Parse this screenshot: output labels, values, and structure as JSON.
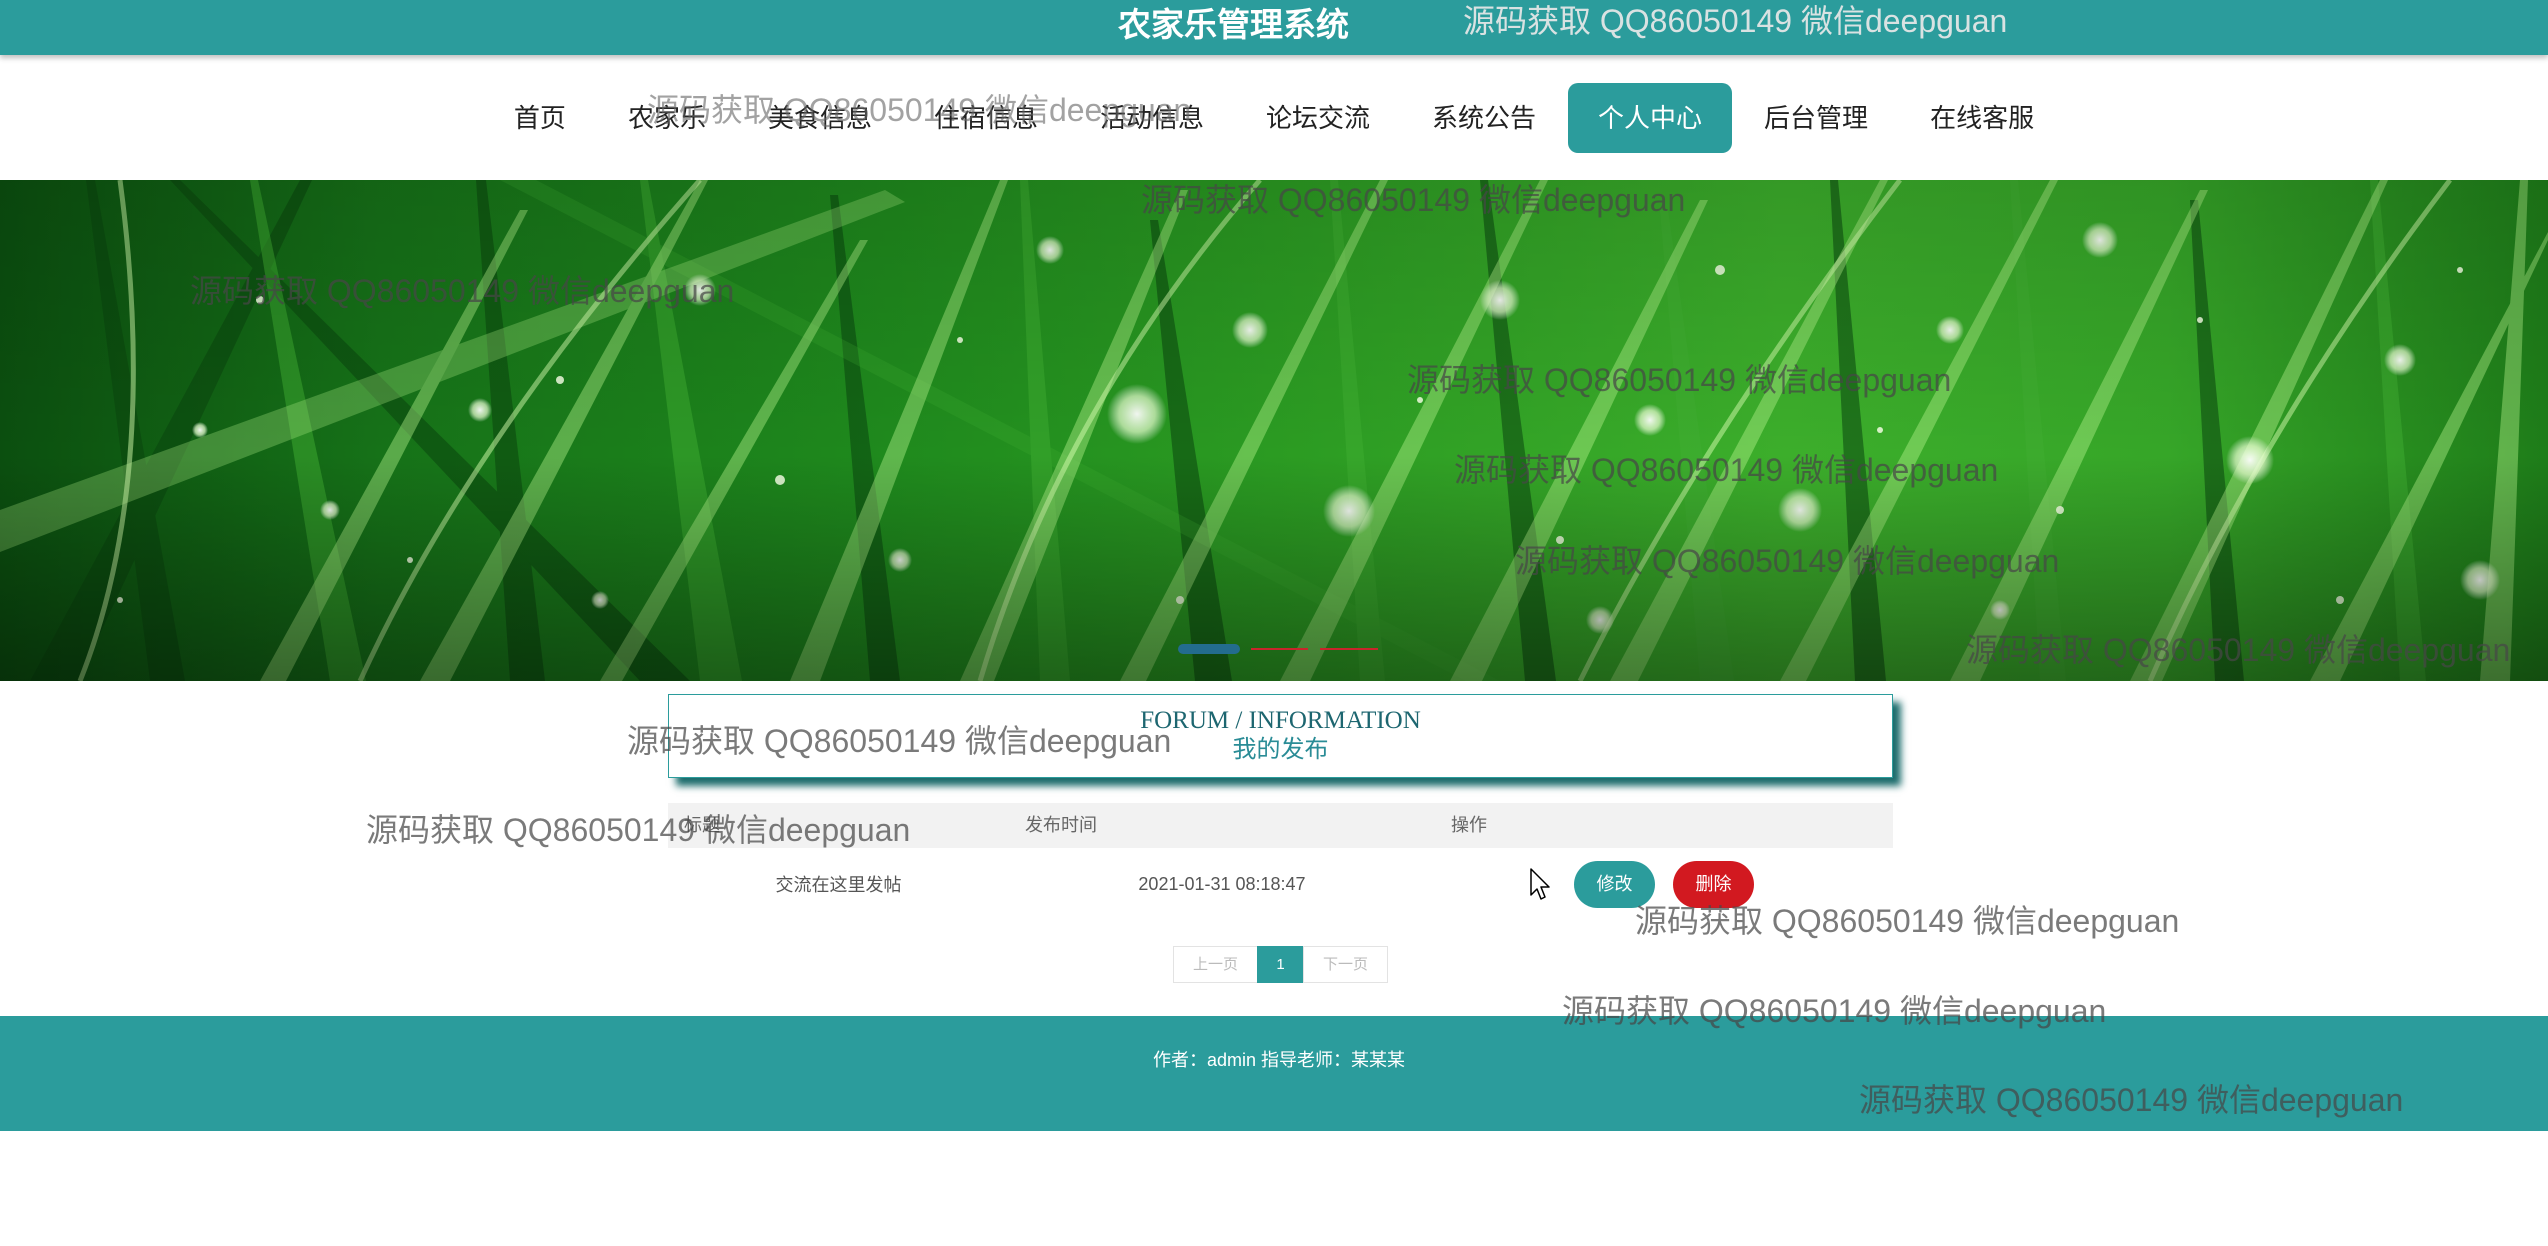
{
  "header": {
    "title": "农家乐管理系统"
  },
  "nav": {
    "items": [
      "首页",
      "农家乐",
      "美食信息",
      "住宿信息",
      "活动信息",
      "论坛交流",
      "系统公告",
      "个人中心",
      "后台管理",
      "在线客服"
    ],
    "active_index": 7
  },
  "section": {
    "title_en": "FORUM / INFORMATION",
    "title_cn": "我的发布"
  },
  "table": {
    "columns": [
      "标题",
      "发布时间",
      "操作"
    ],
    "rows": [
      {
        "title": "交流在这里发帖",
        "time": "2021-01-31 08:18:47",
        "edit_label": "修改",
        "delete_label": "删除"
      }
    ]
  },
  "pagination": {
    "prev": "上一页",
    "current": "1",
    "next": "下一页"
  },
  "footer": {
    "text": "作者：admin 指导老师：某某某"
  },
  "watermark": {
    "text": "源码获取 QQ86050149 微信deepguan"
  },
  "theme": {
    "primary": "#2b9c9c",
    "danger": "#d21920"
  }
}
